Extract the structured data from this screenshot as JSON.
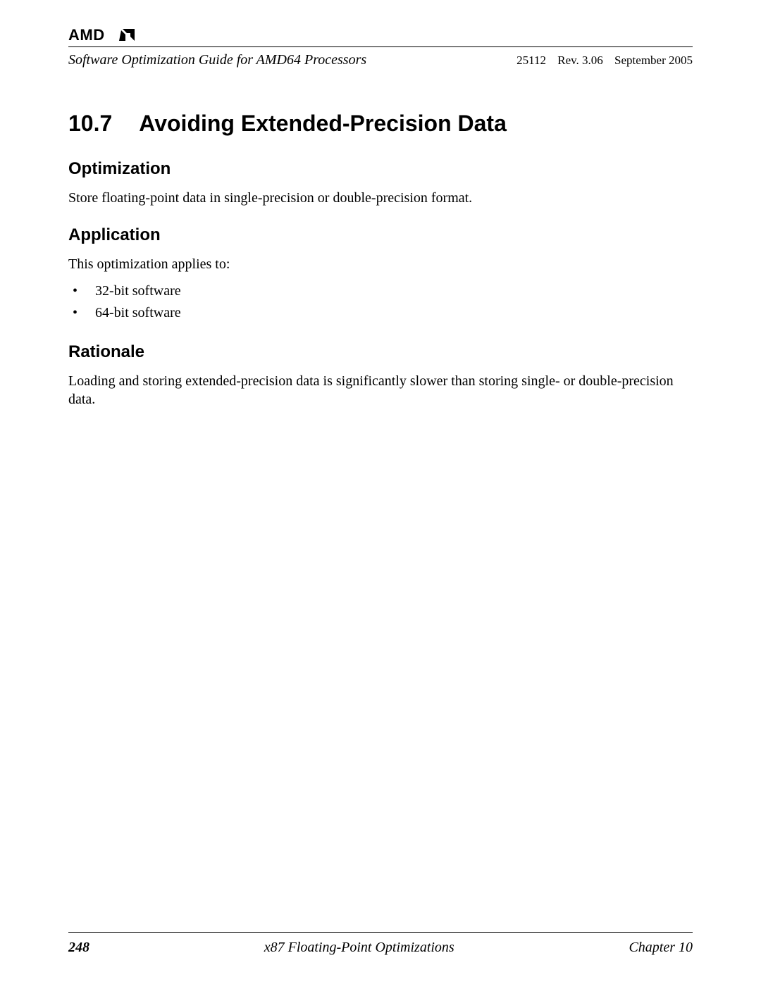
{
  "header": {
    "logo_text": "AMD",
    "title": "Software Optimization Guide for AMD64 Processors",
    "doc_id": "25112",
    "rev": "Rev. 3.06",
    "date": "September 2005"
  },
  "section": {
    "number": "10.7",
    "title": "Avoiding Extended-Precision Data"
  },
  "subsections": {
    "optimization": {
      "heading": "Optimization",
      "text": "Store floating-point data in single-precision or double-precision format."
    },
    "application": {
      "heading": "Application",
      "intro": "This optimization applies to:",
      "items": [
        "32-bit software",
        "64-bit software"
      ]
    },
    "rationale": {
      "heading": "Rationale",
      "text": "Loading and storing extended-precision data is significantly slower than storing single- or double-precision data."
    }
  },
  "footer": {
    "page": "248",
    "title": "x87 Floating-Point Optimizations",
    "chapter": "Chapter 10"
  }
}
